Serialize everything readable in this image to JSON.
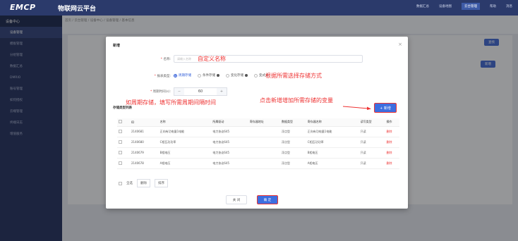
{
  "app": {
    "logo": "EMCP",
    "title": "物联网云平台"
  },
  "topnav": [
    "数据汇总",
    "设备地图",
    "云台管理",
    "帮助",
    "消息"
  ],
  "sidebar": {
    "header": "设备中心",
    "items": [
      "设备管理",
      "模板管理",
      "分组管理",
      "数据汇总",
      "DMRIO",
      "账号管理",
      "如何授权",
      "云端管理",
      "终端日志",
      "增值服务"
    ]
  },
  "breadcrumb": "首页 / 云台管理 / 设备中心 / 设备管理 / 基本信息",
  "background": {
    "filter": "设备基本信息",
    "search_btn": "查找",
    "add_btn": "新增",
    "batch_btn": "新增模板数据",
    "row_id": "25589",
    "col_id": "ID",
    "col_op": "操作",
    "row_ops": "数据管理 | 编辑 | 删除"
  },
  "modal": {
    "title": "新增",
    "name_label": "名称:",
    "name_placeholder": "请输入名称",
    "name_anno": "自定义名称",
    "type_label": "报表类型:",
    "types": [
      "周期存储",
      "条件存储",
      "变化存储",
      "变式式"
    ],
    "selected_type": 0,
    "type_anno": "根据所需选择存储方式",
    "period_label": "周期时间(s):",
    "period_value": "60",
    "period_anno": "如周期存储，填写所需周期间隔时间",
    "var_anno": "点击新增增加所需存储的变量",
    "section_title": "存储类型列表",
    "add_label": "+ 新增",
    "table_headers": [
      "ID",
      "名称",
      "所属驱动",
      "寄存器地址",
      "数据类型",
      "寄存器名称",
      "读写类型",
      "操作"
    ],
    "rows": [
      [
        "2140681",
        "正向有功电量1电能",
        "电力协议645",
        "",
        "浮点型",
        "正向有功电量1电能",
        "只读",
        "删除"
      ],
      [
        "2140680",
        "C相瓦功功率",
        "电力协议645",
        "",
        "浮点型",
        "C相瓦功功率",
        "只读",
        "删除"
      ],
      [
        "2140679",
        "B相电压",
        "电力协议645",
        "",
        "浮点型",
        "B相电压",
        "只读",
        "删除"
      ],
      [
        "2140678",
        "A相电压",
        "电力协议645",
        "",
        "浮点型",
        "A相电压",
        "只读",
        "删除"
      ]
    ],
    "footer": {
      "select_all": "全选",
      "delete": "删除",
      "sort": "排序"
    },
    "cancel_label": "关 闭",
    "ok_label": "确 定"
  }
}
